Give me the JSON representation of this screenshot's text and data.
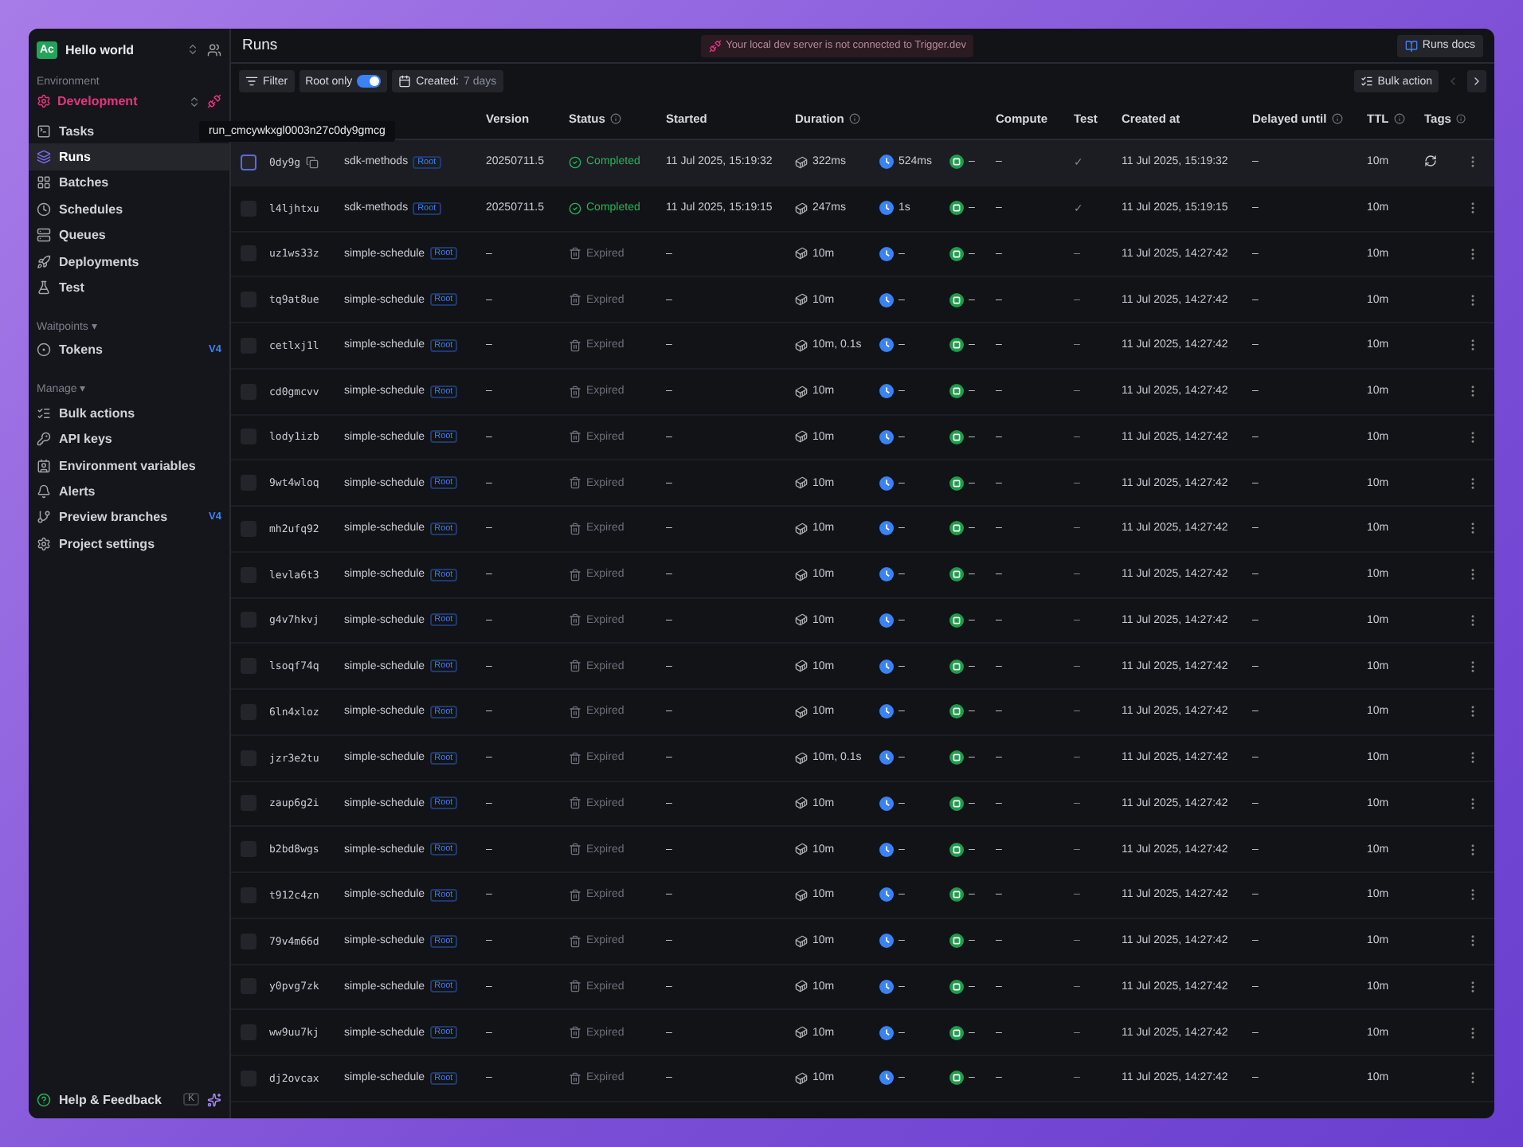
{
  "sidebar": {
    "org_avatar": "Ac",
    "project": "Hello world",
    "environment_label": "Environment",
    "environment": "Development",
    "items": [
      {
        "label": "Tasks",
        "selected": false
      },
      {
        "label": "Runs",
        "selected": true
      },
      {
        "label": "Batches",
        "selected": false
      },
      {
        "label": "Schedules",
        "selected": false
      },
      {
        "label": "Queues",
        "selected": false
      },
      {
        "label": "Deployments",
        "selected": false
      },
      {
        "label": "Test",
        "selected": false
      }
    ],
    "sections": [
      {
        "title": "Waitpoints ▾",
        "items": [
          {
            "label": "Tokens",
            "badge": "V4",
            "selected": false
          }
        ]
      },
      {
        "title": "Manage ▾",
        "items": [
          {
            "label": "Bulk actions",
            "selected": false
          },
          {
            "label": "API keys",
            "selected": false
          },
          {
            "label": "Environment variables",
            "selected": false
          },
          {
            "label": "Alerts",
            "selected": false
          },
          {
            "label": "Preview branches",
            "badge": "V4",
            "selected": false
          },
          {
            "label": "Project settings",
            "selected": false
          }
        ]
      }
    ],
    "footer": {
      "help": "Help & Feedback",
      "shortcut": "K"
    }
  },
  "page_title": "Runs",
  "banner": "Your local dev server is not connected to Trigger.dev",
  "docs_button": "Runs docs",
  "toolbar": {
    "filter": "Filter",
    "root_only": {
      "label": "Root only",
      "on": true
    },
    "created": {
      "label": "Created:",
      "value": "7 days"
    },
    "bulk_action": "Bulk action"
  },
  "tooltip": "run_cmcywkxgl0003n27c0dy9gmcg",
  "table": {
    "columns": [
      {
        "label": "Version",
        "info": false
      },
      {
        "label": "Status",
        "info": true
      },
      {
        "label": "Started",
        "info": false
      },
      {
        "label": "Duration",
        "info": true
      },
      {
        "label": "Compute",
        "info": false
      },
      {
        "label": "Test",
        "info": false
      },
      {
        "label": "Created at",
        "info": false
      },
      {
        "label": "Delayed until",
        "info": true
      },
      {
        "label": "TTL",
        "info": true
      },
      {
        "label": "Tags",
        "info": true
      }
    ],
    "rows": [
      {
        "id": "0dy9g",
        "task": "sdk-methods",
        "badge": "Root",
        "version": "20250711.5",
        "status": {
          "kind": "completed",
          "label": "Completed"
        },
        "started": "11 Jul 2025, 15:19:32",
        "duration": "322ms",
        "queued": "524ms",
        "machine": "–",
        "compute": "–",
        "test": "✓",
        "created": "11 Jul 2025, 15:19:32",
        "delayed": "–",
        "ttl": "10m",
        "hovered": true
      },
      {
        "id": "l4ljhtxu",
        "task": "sdk-methods",
        "badge": "Root",
        "version": "20250711.5",
        "status": {
          "kind": "completed",
          "label": "Completed"
        },
        "started": "11 Jul 2025, 15:19:15",
        "duration": "247ms",
        "queued": "1s",
        "machine": "–",
        "compute": "–",
        "test": "✓",
        "created": "11 Jul 2025, 15:19:15",
        "delayed": "–",
        "ttl": "10m",
        "hovered": false
      },
      {
        "id": "uz1ws33z",
        "task": "simple-schedule",
        "badge": "Root",
        "version": "–",
        "status": {
          "kind": "expired",
          "label": "Expired"
        },
        "started": "–",
        "duration": "10m",
        "queued": "–",
        "machine": "–",
        "compute": "–",
        "test": "–",
        "created": "11 Jul 2025, 14:27:42",
        "delayed": "–",
        "ttl": "10m",
        "hovered": false
      },
      {
        "id": "tq9at8ue",
        "task": "simple-schedule",
        "badge": "Root",
        "version": "–",
        "status": {
          "kind": "expired",
          "label": "Expired"
        },
        "started": "–",
        "duration": "10m",
        "queued": "–",
        "machine": "–",
        "compute": "–",
        "test": "–",
        "created": "11 Jul 2025, 14:27:42",
        "delayed": "–",
        "ttl": "10m",
        "hovered": false
      },
      {
        "id": "cetlxj1l",
        "task": "simple-schedule",
        "badge": "Root",
        "version": "–",
        "status": {
          "kind": "expired",
          "label": "Expired"
        },
        "started": "–",
        "duration": "10m, 0.1s",
        "queued": "–",
        "machine": "–",
        "compute": "–",
        "test": "–",
        "created": "11 Jul 2025, 14:27:42",
        "delayed": "–",
        "ttl": "10m",
        "hovered": false
      },
      {
        "id": "cd0gmcvv",
        "task": "simple-schedule",
        "badge": "Root",
        "version": "–",
        "status": {
          "kind": "expired",
          "label": "Expired"
        },
        "started": "–",
        "duration": "10m",
        "queued": "–",
        "machine": "–",
        "compute": "–",
        "test": "–",
        "created": "11 Jul 2025, 14:27:42",
        "delayed": "–",
        "ttl": "10m",
        "hovered": false
      },
      {
        "id": "lody1izb",
        "task": "simple-schedule",
        "badge": "Root",
        "version": "–",
        "status": {
          "kind": "expired",
          "label": "Expired"
        },
        "started": "–",
        "duration": "10m",
        "queued": "–",
        "machine": "–",
        "compute": "–",
        "test": "–",
        "created": "11 Jul 2025, 14:27:42",
        "delayed": "–",
        "ttl": "10m",
        "hovered": false
      },
      {
        "id": "9wt4wloq",
        "task": "simple-schedule",
        "badge": "Root",
        "version": "–",
        "status": {
          "kind": "expired",
          "label": "Expired"
        },
        "started": "–",
        "duration": "10m",
        "queued": "–",
        "machine": "–",
        "compute": "–",
        "test": "–",
        "created": "11 Jul 2025, 14:27:42",
        "delayed": "–",
        "ttl": "10m",
        "hovered": false
      },
      {
        "id": "mh2ufq92",
        "task": "simple-schedule",
        "badge": "Root",
        "version": "–",
        "status": {
          "kind": "expired",
          "label": "Expired"
        },
        "started": "–",
        "duration": "10m",
        "queued": "–",
        "machine": "–",
        "compute": "–",
        "test": "–",
        "created": "11 Jul 2025, 14:27:42",
        "delayed": "–",
        "ttl": "10m",
        "hovered": false
      },
      {
        "id": "levla6t3",
        "task": "simple-schedule",
        "badge": "Root",
        "version": "–",
        "status": {
          "kind": "expired",
          "label": "Expired"
        },
        "started": "–",
        "duration": "10m",
        "queued": "–",
        "machine": "–",
        "compute": "–",
        "test": "–",
        "created": "11 Jul 2025, 14:27:42",
        "delayed": "–",
        "ttl": "10m",
        "hovered": false
      },
      {
        "id": "g4v7hkvj",
        "task": "simple-schedule",
        "badge": "Root",
        "version": "–",
        "status": {
          "kind": "expired",
          "label": "Expired"
        },
        "started": "–",
        "duration": "10m",
        "queued": "–",
        "machine": "–",
        "compute": "–",
        "test": "–",
        "created": "11 Jul 2025, 14:27:42",
        "delayed": "–",
        "ttl": "10m",
        "hovered": false
      },
      {
        "id": "lsoqf74q",
        "task": "simple-schedule",
        "badge": "Root",
        "version": "–",
        "status": {
          "kind": "expired",
          "label": "Expired"
        },
        "started": "–",
        "duration": "10m",
        "queued": "–",
        "machine": "–",
        "compute": "–",
        "test": "–",
        "created": "11 Jul 2025, 14:27:42",
        "delayed": "–",
        "ttl": "10m",
        "hovered": false
      },
      {
        "id": "6ln4xloz",
        "task": "simple-schedule",
        "badge": "Root",
        "version": "–",
        "status": {
          "kind": "expired",
          "label": "Expired"
        },
        "started": "–",
        "duration": "10m",
        "queued": "–",
        "machine": "–",
        "compute": "–",
        "test": "–",
        "created": "11 Jul 2025, 14:27:42",
        "delayed": "–",
        "ttl": "10m",
        "hovered": false
      },
      {
        "id": "jzr3e2tu",
        "task": "simple-schedule",
        "badge": "Root",
        "version": "–",
        "status": {
          "kind": "expired",
          "label": "Expired"
        },
        "started": "–",
        "duration": "10m, 0.1s",
        "queued": "–",
        "machine": "–",
        "compute": "–",
        "test": "–",
        "created": "11 Jul 2025, 14:27:42",
        "delayed": "–",
        "ttl": "10m",
        "hovered": false
      },
      {
        "id": "zaup6g2i",
        "task": "simple-schedule",
        "badge": "Root",
        "version": "–",
        "status": {
          "kind": "expired",
          "label": "Expired"
        },
        "started": "–",
        "duration": "10m",
        "queued": "–",
        "machine": "–",
        "compute": "–",
        "test": "–",
        "created": "11 Jul 2025, 14:27:42",
        "delayed": "–",
        "ttl": "10m",
        "hovered": false
      },
      {
        "id": "b2bd8wgs",
        "task": "simple-schedule",
        "badge": "Root",
        "version": "–",
        "status": {
          "kind": "expired",
          "label": "Expired"
        },
        "started": "–",
        "duration": "10m",
        "queued": "–",
        "machine": "–",
        "compute": "–",
        "test": "–",
        "created": "11 Jul 2025, 14:27:42",
        "delayed": "–",
        "ttl": "10m",
        "hovered": false
      },
      {
        "id": "t912c4zn",
        "task": "simple-schedule",
        "badge": "Root",
        "version": "–",
        "status": {
          "kind": "expired",
          "label": "Expired"
        },
        "started": "–",
        "duration": "10m",
        "queued": "–",
        "machine": "–",
        "compute": "–",
        "test": "–",
        "created": "11 Jul 2025, 14:27:42",
        "delayed": "–",
        "ttl": "10m",
        "hovered": false
      },
      {
        "id": "79v4m66d",
        "task": "simple-schedule",
        "badge": "Root",
        "version": "–",
        "status": {
          "kind": "expired",
          "label": "Expired"
        },
        "started": "–",
        "duration": "10m",
        "queued": "–",
        "machine": "–",
        "compute": "–",
        "test": "–",
        "created": "11 Jul 2025, 14:27:42",
        "delayed": "–",
        "ttl": "10m",
        "hovered": false
      },
      {
        "id": "y0pvg7zk",
        "task": "simple-schedule",
        "badge": "Root",
        "version": "–",
        "status": {
          "kind": "expired",
          "label": "Expired"
        },
        "started": "–",
        "duration": "10m",
        "queued": "–",
        "machine": "–",
        "compute": "–",
        "test": "–",
        "created": "11 Jul 2025, 14:27:42",
        "delayed": "–",
        "ttl": "10m",
        "hovered": false
      },
      {
        "id": "ww9uu7kj",
        "task": "simple-schedule",
        "badge": "Root",
        "version": "–",
        "status": {
          "kind": "expired",
          "label": "Expired"
        },
        "started": "–",
        "duration": "10m",
        "queued": "–",
        "machine": "–",
        "compute": "–",
        "test": "–",
        "created": "11 Jul 2025, 14:27:42",
        "delayed": "–",
        "ttl": "10m",
        "hovered": false
      },
      {
        "id": "dj2ovcax",
        "task": "simple-schedule",
        "badge": "Root",
        "version": "–",
        "status": {
          "kind": "expired",
          "label": "Expired"
        },
        "started": "–",
        "duration": "10m",
        "queued": "–",
        "machine": "–",
        "compute": "–",
        "test": "–",
        "created": "11 Jul 2025, 14:27:42",
        "delayed": "–",
        "ttl": "10m",
        "hovered": false
      }
    ]
  }
}
